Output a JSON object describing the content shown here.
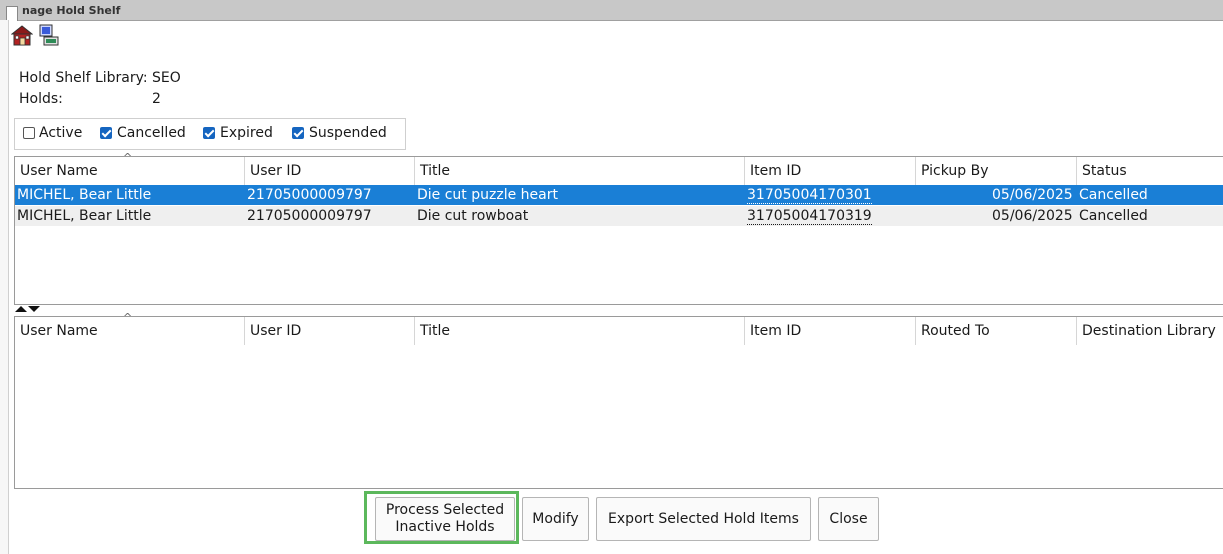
{
  "window": {
    "title": "nage Hold Shelf"
  },
  "toolbar": {
    "home_icon": "house-icon",
    "export_icon": "computer-export-icon"
  },
  "info": {
    "library_label": "Hold Shelf Library:",
    "library_value": "SEO",
    "holds_label": "Holds:",
    "holds_value": "2"
  },
  "filters": [
    {
      "label": "Active",
      "checked": false
    },
    {
      "label": "Cancelled",
      "checked": true
    },
    {
      "label": "Expired",
      "checked": true
    },
    {
      "label": "Suspended",
      "checked": true
    }
  ],
  "top_grid": {
    "columns": [
      "User Name",
      "User ID",
      "Title",
      "Item ID",
      "Pickup By",
      "Status"
    ],
    "rows": [
      {
        "user_name": "MICHEL, Bear Little",
        "user_id": "21705000009797",
        "title": "Die cut puzzle heart",
        "item_id": "31705004170301",
        "pickup_by": "05/06/2025",
        "status": "Cancelled",
        "selected": true
      },
      {
        "user_name": "MICHEL, Bear Little",
        "user_id": "21705000009797",
        "title": "Die cut rowboat",
        "item_id": "31705004170319",
        "pickup_by": "05/06/2025",
        "status": "Cancelled",
        "selected": false
      }
    ]
  },
  "bottom_grid": {
    "columns": [
      "User Name",
      "User ID",
      "Title",
      "Item ID",
      "Routed To",
      "Destination Library"
    ]
  },
  "buttons": {
    "process_line1": "Process Selected",
    "process_line2": "Inactive Holds",
    "modify": "Modify",
    "export": "Export Selected Hold Items",
    "close": "Close"
  },
  "colors": {
    "selection": "#1a7fd6",
    "highlight": "#5cb85c",
    "checkbox": "#1565c0"
  }
}
